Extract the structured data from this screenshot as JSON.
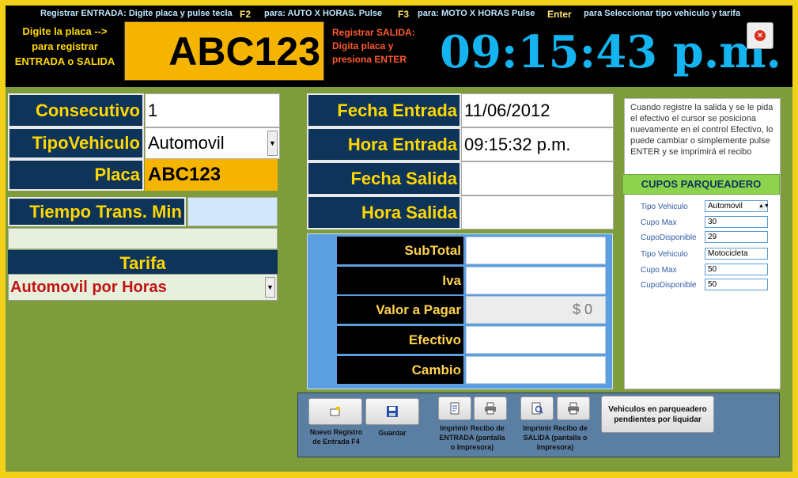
{
  "hints": {
    "registrar_entrada": "Registrar ENTRADA: Digite placa y pulse tecla",
    "key_f2": "F2",
    "para_auto": "para:  AUTO X  HORAS.  Pulse",
    "key_f3": "F3",
    "para_moto": "para: MOTO X HORAS  Pulse",
    "key_enter": "Enter",
    "para_seleccionar": "para Seleccionar tipo vehiculo y tarifa"
  },
  "header": {
    "prompt_left_1": "Digite la placa -->",
    "prompt_left_2": "para registrar",
    "prompt_left_3": "ENTRADA o SALIDA",
    "plate_input": "ABC123",
    "prompt_salida_1": "Registrar SALIDA:",
    "prompt_salida_2": "Digita placa y",
    "prompt_salida_3": "presiona ENTER",
    "clock": "09:15:43 p.m."
  },
  "left_form": {
    "consecutivo_label": "Consecutivo",
    "consecutivo_value": "1",
    "tipo_label": "TipoVehiculo",
    "tipo_value": "Automovil",
    "placa_label": "Placa",
    "placa_value": "ABC123",
    "tiempo_label": "Tiempo Trans. Min",
    "tiempo_value": "",
    "tarifa_label": "Tarifa",
    "tarifa_value": "Automovil por Horas"
  },
  "mid_form": {
    "fecha_entrada_label": "Fecha Entrada",
    "fecha_entrada_value": "11/06/2012",
    "hora_entrada_label": "Hora Entrada",
    "hora_entrada_value": "09:15:32 p.m.",
    "fecha_salida_label": "Fecha Salida",
    "fecha_salida_value": "",
    "hora_salida_label": "Hora Salida",
    "hora_salida_value": ""
  },
  "payment": {
    "subtotal_label": "SubTotal",
    "iva_label": "Iva",
    "valor_label": "Valor a Pagar",
    "valor_value": "$ 0",
    "efectivo_label": "Efectivo",
    "cambio_label": "Cambio"
  },
  "info": {
    "text": "Cuando registre la salida y se le pida el efectivo el cursor se posiciona nuevamente en el control Efectivo, lo puede cambiar o simplemente pulse ENTER y se imprimirá el recibo"
  },
  "cupos": {
    "title": "CUPOS PARQUEADERO",
    "rows": [
      {
        "label": "Tipo Vehiculo",
        "value": "Automovil"
      },
      {
        "label": "Cupo Max",
        "value": "30"
      },
      {
        "label": "CupoDisponible",
        "value": "29"
      },
      {
        "label": "Tipo Vehiculo",
        "value": "Motocicleta"
      },
      {
        "label": "Cupo Max",
        "value": "50"
      },
      {
        "label": "CupoDisponible",
        "value": "50"
      }
    ]
  },
  "buttons": {
    "nuevo_1": "Nuevo Registro",
    "nuevo_2": "de Entrada F4",
    "guardar": "Guardar",
    "imp_entrada_1": "Imprimir Recibo de",
    "imp_entrada_2": "ENTRADA (pantalla",
    "imp_entrada_3": "o Impresora)",
    "imp_salida_1": "Imprimir Recibo de",
    "imp_salida_2": "SALIDA (pantalla o",
    "imp_salida_3": "Impresora)",
    "pendientes_1": "Vehiculos en parqueadero",
    "pendientes_2": "pendientes por liquidar"
  },
  "icons": {
    "close": "close-icon",
    "combo": "chevron-down-icon",
    "nuevo": "new-record-icon",
    "guardar": "save-icon",
    "preview": "preview-icon",
    "printer": "printer-icon"
  },
  "colors": {
    "frame": "#f2d11a",
    "background": "#7f9c3c",
    "label_bg": "#0e3459",
    "label_text": "#ffd700",
    "clock": "#14b4f0",
    "plate_bg": "#f5b400",
    "tarifa_text": "#c21414",
    "cupos_head": "#8ed34e"
  }
}
